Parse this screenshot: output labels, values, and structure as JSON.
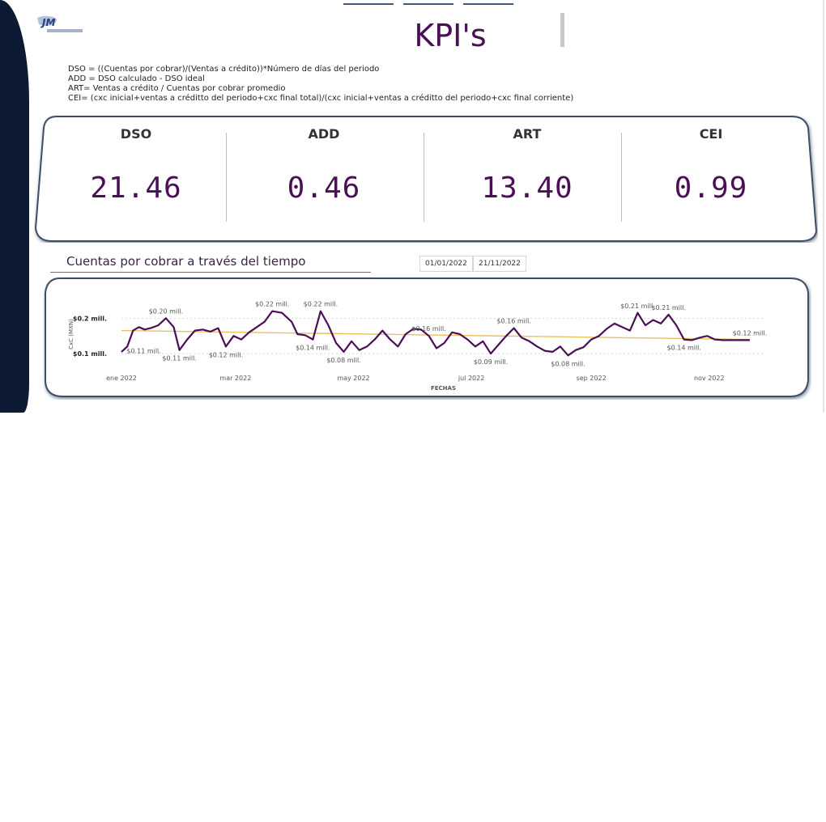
{
  "page": {
    "title": "KPI's",
    "formulas": [
      "DSO = ((Cuentas por cobrar)/(Ventas a crédito))*Número de días del periodo",
      "ADD = DSO calculado - DSO ideal",
      "ART= Ventas a crédito / Cuentas por cobrar promedio",
      "CEI= (cxc inicial+ventas a créditto  del periodo+cxc final total)/(cxc inicial+ventas a créditto del  periodo+cxc final corriente)"
    ]
  },
  "kpis": [
    {
      "label": "DSO",
      "value": "21.46"
    },
    {
      "label": "ADD",
      "value": "0.46"
    },
    {
      "label": "ART",
      "value": "13.40"
    },
    {
      "label": "CEI",
      "value": "0.99"
    }
  ],
  "chart_section": {
    "title": "Cuentas por cobrar a través del tiempo",
    "date_start": "01/01/2022",
    "date_end": "21/11/2022"
  },
  "colors": {
    "accent": "#4a0f55",
    "trend": "#e8c060",
    "sidebar": "#0c1a33"
  },
  "chart_data": {
    "type": "line",
    "xlabel": "FECHAS",
    "ylabel": "CxC (MXN)",
    "xtick_labels": [
      "ene 2022",
      "mar 2022",
      "may 2022",
      "jul 2022",
      "sep 2022",
      "nov 2022"
    ],
    "xtick_dates": [
      "2022-01-01",
      "2022-03-01",
      "2022-05-01",
      "2022-07-01",
      "2022-09-01",
      "2022-11-01"
    ],
    "ytick_labels": [
      "$0.1 mill.",
      "$0.2 mill."
    ],
    "ytick_values": [
      0.1,
      0.2
    ],
    "ylim": [
      0.075,
      0.235
    ],
    "xlim": [
      "2022-01-01",
      "2022-11-30"
    ],
    "grid": true,
    "series": [
      {
        "color": "#4a0f55",
        "points": [
          [
            "2022-01-01",
            0.105
          ],
          [
            "2022-01-04",
            0.12
          ],
          [
            "2022-01-07",
            0.165
          ],
          [
            "2022-01-10",
            0.175
          ],
          [
            "2022-01-13",
            0.168
          ],
          [
            "2022-01-16",
            0.172
          ],
          [
            "2022-01-20",
            0.18
          ],
          [
            "2022-01-24",
            0.2
          ],
          [
            "2022-01-28",
            0.175
          ],
          [
            "2022-01-31",
            0.11
          ],
          [
            "2022-02-04",
            0.14
          ],
          [
            "2022-02-08",
            0.165
          ],
          [
            "2022-02-12",
            0.168
          ],
          [
            "2022-02-16",
            0.162
          ],
          [
            "2022-02-20",
            0.172
          ],
          [
            "2022-02-24",
            0.12
          ],
          [
            "2022-02-28",
            0.15
          ],
          [
            "2022-03-04",
            0.14
          ],
          [
            "2022-03-08",
            0.16
          ],
          [
            "2022-03-12",
            0.175
          ],
          [
            "2022-03-16",
            0.19
          ],
          [
            "2022-03-20",
            0.22
          ],
          [
            "2022-03-25",
            0.215
          ],
          [
            "2022-03-30",
            0.19
          ],
          [
            "2022-04-02",
            0.155
          ],
          [
            "2022-04-06",
            0.152
          ],
          [
            "2022-04-10",
            0.14
          ],
          [
            "2022-04-14",
            0.22
          ],
          [
            "2022-04-18",
            0.18
          ],
          [
            "2022-04-22",
            0.13
          ],
          [
            "2022-04-26",
            0.105
          ],
          [
            "2022-04-30",
            0.135
          ],
          [
            "2022-05-04",
            0.11
          ],
          [
            "2022-05-08",
            0.12
          ],
          [
            "2022-05-12",
            0.14
          ],
          [
            "2022-05-16",
            0.165
          ],
          [
            "2022-05-20",
            0.14
          ],
          [
            "2022-05-24",
            0.12
          ],
          [
            "2022-05-28",
            0.155
          ],
          [
            "2022-06-01",
            0.17
          ],
          [
            "2022-06-05",
            0.168
          ],
          [
            "2022-06-09",
            0.15
          ],
          [
            "2022-06-13",
            0.115
          ],
          [
            "2022-06-17",
            0.13
          ],
          [
            "2022-06-21",
            0.16
          ],
          [
            "2022-06-25",
            0.155
          ],
          [
            "2022-06-29",
            0.14
          ],
          [
            "2022-07-03",
            0.12
          ],
          [
            "2022-07-07",
            0.135
          ],
          [
            "2022-07-11",
            0.1
          ],
          [
            "2022-07-15",
            0.125
          ],
          [
            "2022-07-19",
            0.15
          ],
          [
            "2022-07-23",
            0.172
          ],
          [
            "2022-07-27",
            0.145
          ],
          [
            "2022-07-31",
            0.135
          ],
          [
            "2022-08-04",
            0.12
          ],
          [
            "2022-08-08",
            0.108
          ],
          [
            "2022-08-12",
            0.105
          ],
          [
            "2022-08-16",
            0.12
          ],
          [
            "2022-08-20",
            0.095
          ],
          [
            "2022-08-24",
            0.11
          ],
          [
            "2022-08-28",
            0.118
          ],
          [
            "2022-09-01",
            0.14
          ],
          [
            "2022-09-05",
            0.15
          ],
          [
            "2022-09-09",
            0.17
          ],
          [
            "2022-09-13",
            0.185
          ],
          [
            "2022-09-17",
            0.175
          ],
          [
            "2022-09-21",
            0.165
          ],
          [
            "2022-09-25",
            0.215
          ],
          [
            "2022-09-29",
            0.18
          ],
          [
            "2022-10-03",
            0.195
          ],
          [
            "2022-10-07",
            0.185
          ],
          [
            "2022-10-11",
            0.21
          ],
          [
            "2022-10-15",
            0.18
          ],
          [
            "2022-10-19",
            0.14
          ],
          [
            "2022-10-23",
            0.138
          ],
          [
            "2022-10-27",
            0.145
          ],
          [
            "2022-10-31",
            0.15
          ],
          [
            "2022-11-04",
            0.14
          ],
          [
            "2022-11-08",
            0.138
          ],
          [
            "2022-11-12",
            0.138
          ],
          [
            "2022-11-16",
            0.138
          ],
          [
            "2022-11-22",
            0.138
          ]
        ]
      },
      {
        "color": "#e8c060",
        "points": [
          [
            "2022-01-01",
            0.165
          ],
          [
            "2022-11-22",
            0.14
          ]
        ]
      }
    ],
    "data_labels": [
      {
        "date": "2022-01-02",
        "value": 0.11,
        "text": "$0.11 mill.",
        "pos": "right"
      },
      {
        "date": "2022-01-24",
        "value": 0.2,
        "text": "$0.20 mill.",
        "pos": "above"
      },
      {
        "date": "2022-01-31",
        "value": 0.11,
        "text": "$0.11 mill.",
        "pos": "below"
      },
      {
        "date": "2022-02-24",
        "value": 0.12,
        "text": "$0.12 mill.",
        "pos": "below"
      },
      {
        "date": "2022-03-20",
        "value": 0.22,
        "text": "$0.22 mill.",
        "pos": "above"
      },
      {
        "date": "2022-04-10",
        "value": 0.14,
        "text": "$0.14 mill.",
        "pos": "below"
      },
      {
        "date": "2022-04-14",
        "value": 0.22,
        "text": "$0.22 mill.",
        "pos": "above"
      },
      {
        "date": "2022-04-26",
        "value": 0.105,
        "text": "$0.08 mill.",
        "pos": "below"
      },
      {
        "date": "2022-06-09",
        "value": 0.15,
        "text": "$0.16 mill.",
        "pos": "above"
      },
      {
        "date": "2022-07-11",
        "value": 0.1,
        "text": "$0.09 mill.",
        "pos": "below"
      },
      {
        "date": "2022-07-23",
        "value": 0.172,
        "text": "$0.16 mill.",
        "pos": "above"
      },
      {
        "date": "2022-08-20",
        "value": 0.095,
        "text": "$0.08 mill.",
        "pos": "below"
      },
      {
        "date": "2022-09-25",
        "value": 0.215,
        "text": "$0.21 mill.",
        "pos": "above"
      },
      {
        "date": "2022-10-11",
        "value": 0.21,
        "text": "$0.21 mill.",
        "pos": "above"
      },
      {
        "date": "2022-10-19",
        "value": 0.14,
        "text": "$0.14 mill.",
        "pos": "below"
      },
      {
        "date": "2022-11-22",
        "value": 0.138,
        "text": "$0.12 mill.",
        "pos": "above"
      }
    ]
  }
}
